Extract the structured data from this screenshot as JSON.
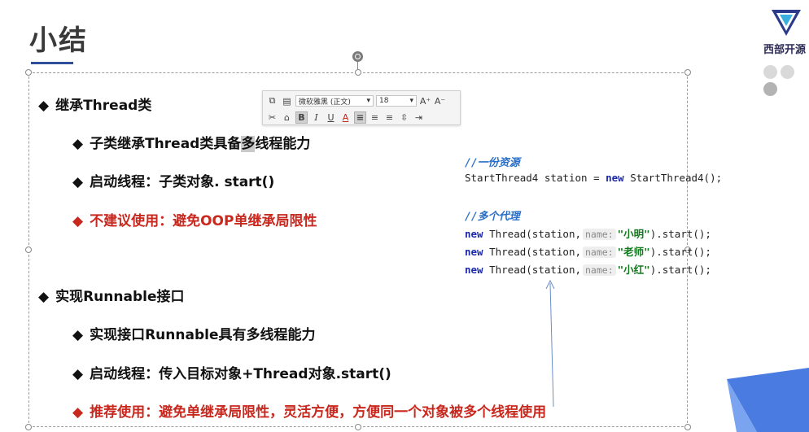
{
  "slide": {
    "title": "小结"
  },
  "brand": {
    "logo_text": "西部开源",
    "logo_icon": "v-shape-logo-icon",
    "accent_color": "#2f4f9a"
  },
  "bullets": {
    "b1": "继承Thread类",
    "b1_1": "子类继承Thread类具备",
    "b1_1_highlight": "多",
    "b1_1_tail": "线程能力",
    "b1_2": "启动线程：子类对象. start()",
    "b1_3": "不建议使用：避免OOP单继承局限性",
    "b2": "实现Runnable接口",
    "b2_1": "实现接口Runnable具有多线程能力",
    "b2_2": "启动线程：传入目标对象+Thread对象.start()",
    "b2_3": "推荐使用：避免单继承局限性，灵活方便，方便同一个对象被多个线程使用",
    "mark": "◆",
    "red_color": "#c8281e"
  },
  "toolbar": {
    "font_name": "微软雅黑 (正文)",
    "font_size": "18",
    "grow_font": "A⁺",
    "shrink_font": "A⁻",
    "bold": "B",
    "italic": "I",
    "underline": "U",
    "font_color": "A"
  },
  "code": {
    "comment1": "//一份资源",
    "line1_type": "StartThread4",
    "line1_var": "station",
    "line1_eq": "=",
    "line1_new": "new",
    "line1_ctor": "StartThread4();",
    "comment2": "//多个代理",
    "new_kw": "new",
    "thread_call": "Thread(station,",
    "hint": "name:",
    "arg1": "\"小明\"",
    "arg2": "\"老师\"",
    "arg3": "\"小红\"",
    "tail": ").start();"
  }
}
